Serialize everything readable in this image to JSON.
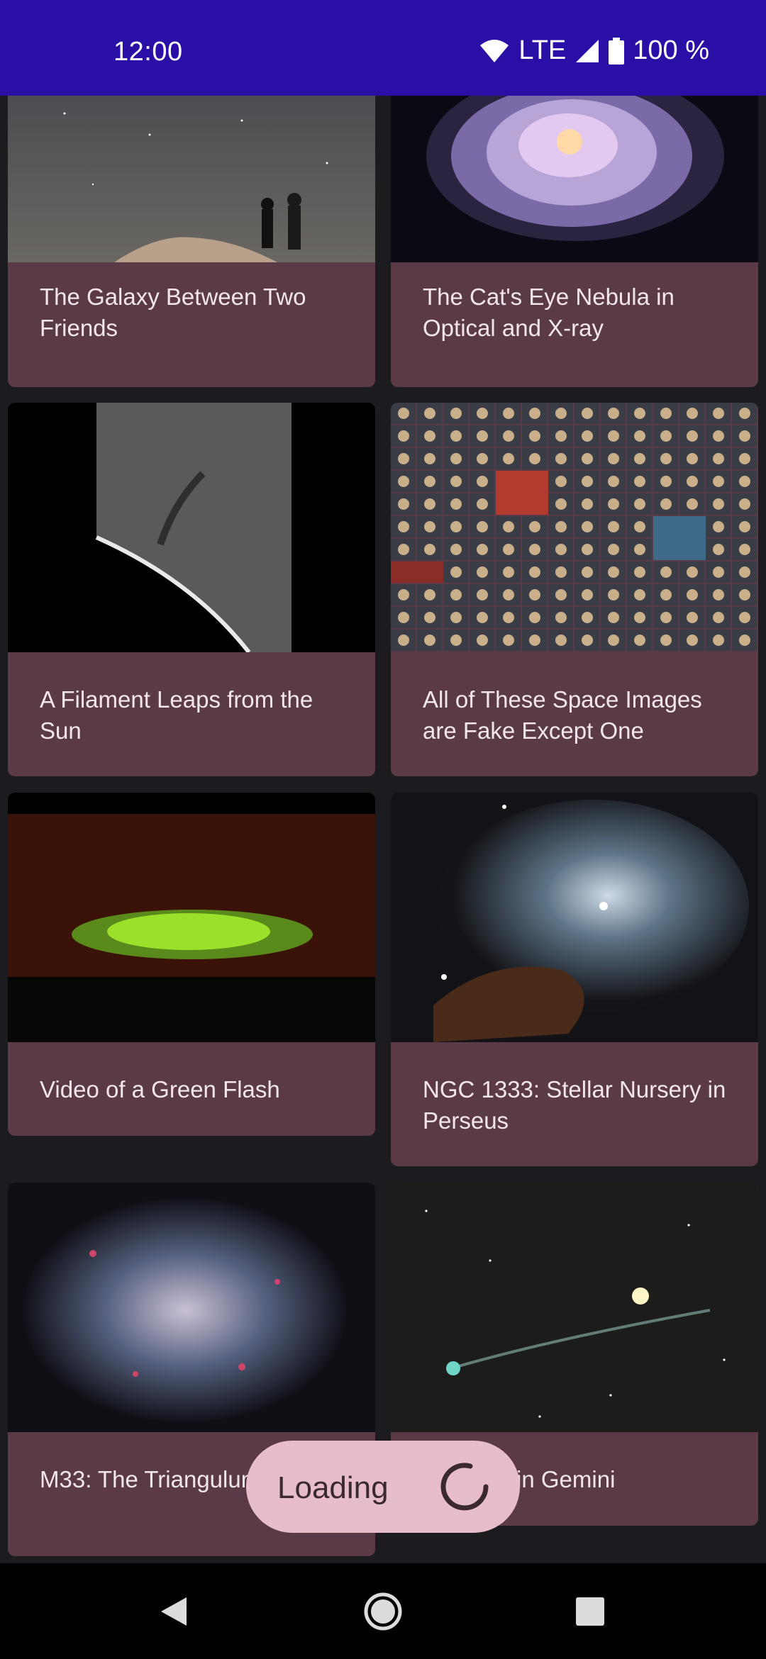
{
  "status_bar": {
    "time": "12:00",
    "network": "LTE",
    "battery": "100 %",
    "icons": [
      "wifi-icon",
      "cell-signal-icon",
      "battery-icon"
    ]
  },
  "cards": [
    {
      "title": "The Galaxy Between Two Friends"
    },
    {
      "title": "The Cat's Eye Nebula in Optical and X-ray"
    },
    {
      "title": "A Filament Leaps from the Sun"
    },
    {
      "title": "All of These Space Images are Fake Except One"
    },
    {
      "title": "Video of a Green Flash"
    },
    {
      "title": "NGC 1333: Stellar Nursery in Perseus"
    },
    {
      "title": "M33: The Triangulum Galaxy"
    },
    {
      "title": "s Comet in Gemini"
    }
  ],
  "loading": {
    "label": "Loading"
  },
  "nav_bar": {
    "icons": [
      "back-icon",
      "home-icon",
      "recents-icon"
    ]
  },
  "colors": {
    "status_bar": "#2a0ea6",
    "background": "#1c1b1f",
    "card": "#5b3a47",
    "loading_pill": "#e7bdca"
  }
}
